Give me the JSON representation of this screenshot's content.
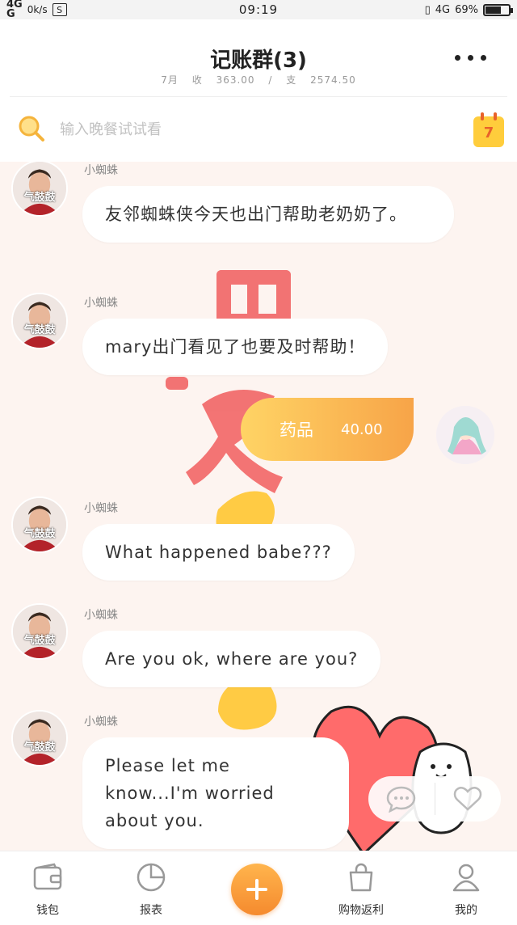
{
  "status_bar": {
    "signal": "4G",
    "signal_sub": "G",
    "speed": "0k/s",
    "time": "09:19",
    "network": "4G",
    "battery": "69%",
    "battery_level": 0.69
  },
  "header": {
    "title": "记账群(3)",
    "month": "7月",
    "income_label": "收",
    "income": "363.00",
    "separator": "/",
    "expense_label": "支",
    "expense": "2574.50",
    "calendar_day": "7"
  },
  "search": {
    "placeholder": "输入晚餐试试看"
  },
  "messages": [
    {
      "sender": "小蜘蛛",
      "avatar_tag": "气鼓鼓",
      "text": "友邻蜘蛛侠今天也出门帮助老奶奶了。"
    },
    {
      "sender": "小蜘蛛",
      "avatar_tag": "气鼓鼓",
      "text": "mary出门看见了也要及时帮助！"
    },
    {
      "sender": "小蜘蛛",
      "avatar_tag": "气鼓鼓",
      "text": "What happened babe???"
    },
    {
      "sender": "小蜘蛛",
      "avatar_tag": "气鼓鼓",
      "text": "Are you ok,  where are you?"
    },
    {
      "sender": "小蜘蛛",
      "avatar_tag": "气鼓鼓",
      "text": "Please let me know...I'm worried about you."
    }
  ],
  "outgoing": {
    "category": "药品",
    "amount": "40.00"
  },
  "bottom_nav": [
    {
      "label": "钱包",
      "icon": "wallet-icon"
    },
    {
      "label": "报表",
      "icon": "pie-chart-icon"
    },
    {
      "label": "",
      "icon": "plus-icon"
    },
    {
      "label": "购物返利",
      "icon": "shopping-bag-icon"
    },
    {
      "label": "我的",
      "icon": "user-icon"
    }
  ],
  "colors": {
    "accent": "#f7a448",
    "accent_light": "#ffd465",
    "background": "#fdf4f0",
    "calendar": "#ffcd3c"
  }
}
